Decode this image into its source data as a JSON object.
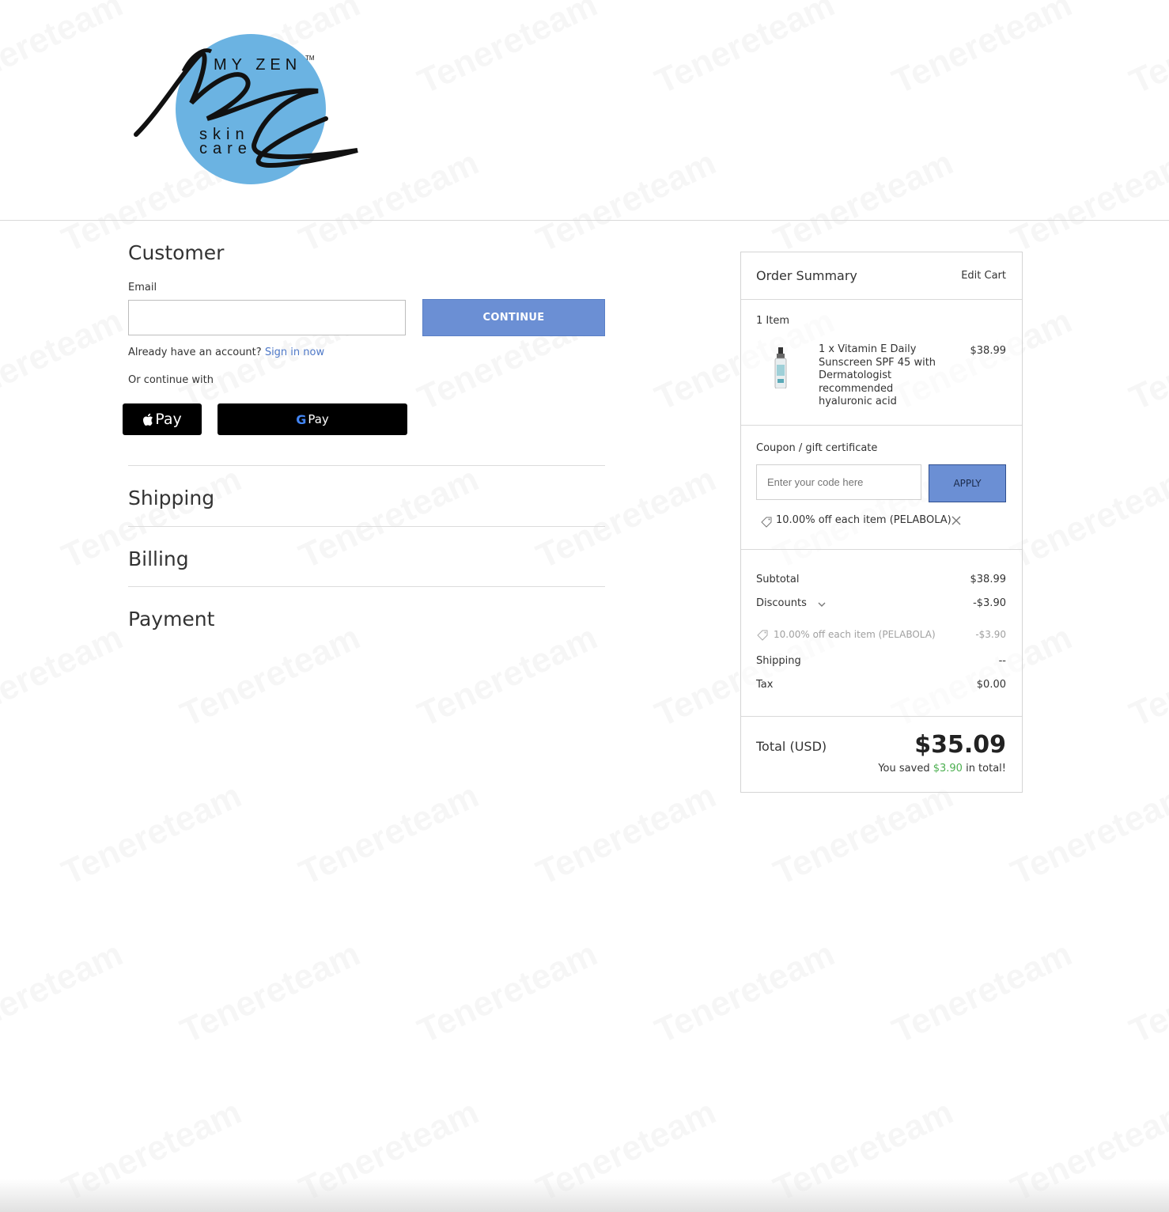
{
  "brand": {
    "logo_line1": "MY ZEN",
    "logo_tm": "TM",
    "logo_line2": "skin",
    "logo_line3": "care",
    "logo_color": "#6bb3e2"
  },
  "watermark": "Tenereteam",
  "customer": {
    "heading": "Customer",
    "email_label": "Email",
    "email_value": "",
    "continue_label": "CONTINUE",
    "account_prompt": "Already have an account?",
    "sign_in_label": "Sign in now",
    "or_continue": "Or continue with",
    "apple_pay_label": "Pay",
    "google_pay_g": "G",
    "google_pay_label": "Pay"
  },
  "sections": {
    "shipping": "Shipping",
    "billing": "Billing",
    "payment": "Payment"
  },
  "summary": {
    "title": "Order Summary",
    "edit_cart": "Edit Cart",
    "item_count": "1 Item",
    "product_name": "1 x Vitamin E Daily Sunscreen SPF 45 with Dermatologist recommended hyaluronic acid",
    "product_price": "$38.99",
    "coupon_link": "Coupon / gift certificate",
    "coupon_placeholder": "Enter your code here",
    "apply_label": "APPLY",
    "applied_coupon": "10.00% off each item (PELABOLA)",
    "subtotal_label": "Subtotal",
    "subtotal_value": "$38.99",
    "discounts_label": "Discounts",
    "discounts_value": "-$3.90",
    "discount_detail_label": "10.00% off each item (PELABOLA)",
    "discount_detail_value": "-$3.90",
    "shipping_label": "Shipping",
    "shipping_value": "--",
    "tax_label": "Tax",
    "tax_value": "$0.00",
    "total_label": "Total (USD)",
    "total_value": "$35.09",
    "saved_prefix": "You saved",
    "saved_amount": "$3.90",
    "saved_suffix": "in total!"
  },
  "colors": {
    "accent": "#6b8fd4",
    "link": "#4f79c8",
    "saved_green": "#4caf50"
  }
}
